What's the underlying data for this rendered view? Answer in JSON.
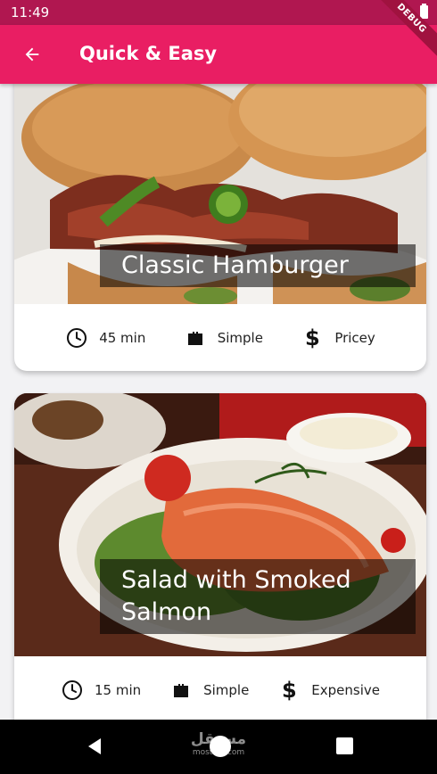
{
  "status_bar": {
    "time": "11:49"
  },
  "app_bar": {
    "title": "Quick & Easy",
    "back_icon": "arrow-left-icon",
    "debug_label": "DEBUG"
  },
  "colors": {
    "primary": "#e91e63",
    "status_bar": "#b01750",
    "overlay": "rgba(0,0,0,0.55)"
  },
  "recipes": [
    {
      "title": "Classic Hamburger",
      "duration": "45 min",
      "complexity": "Simple",
      "affordability": "Pricey",
      "image": "hamburger-photo"
    },
    {
      "title": "Salad with Smoked Salmon",
      "duration": "15 min",
      "complexity": "Simple",
      "affordability": "Expensive",
      "image": "salmon-salad-photo"
    }
  ],
  "icons": {
    "duration": "clock-icon",
    "complexity": "briefcase-icon",
    "affordability": "dollar-icon"
  },
  "nav_bar": {
    "watermark_ar": "مستقل",
    "watermark_en": "mostaql.com"
  }
}
